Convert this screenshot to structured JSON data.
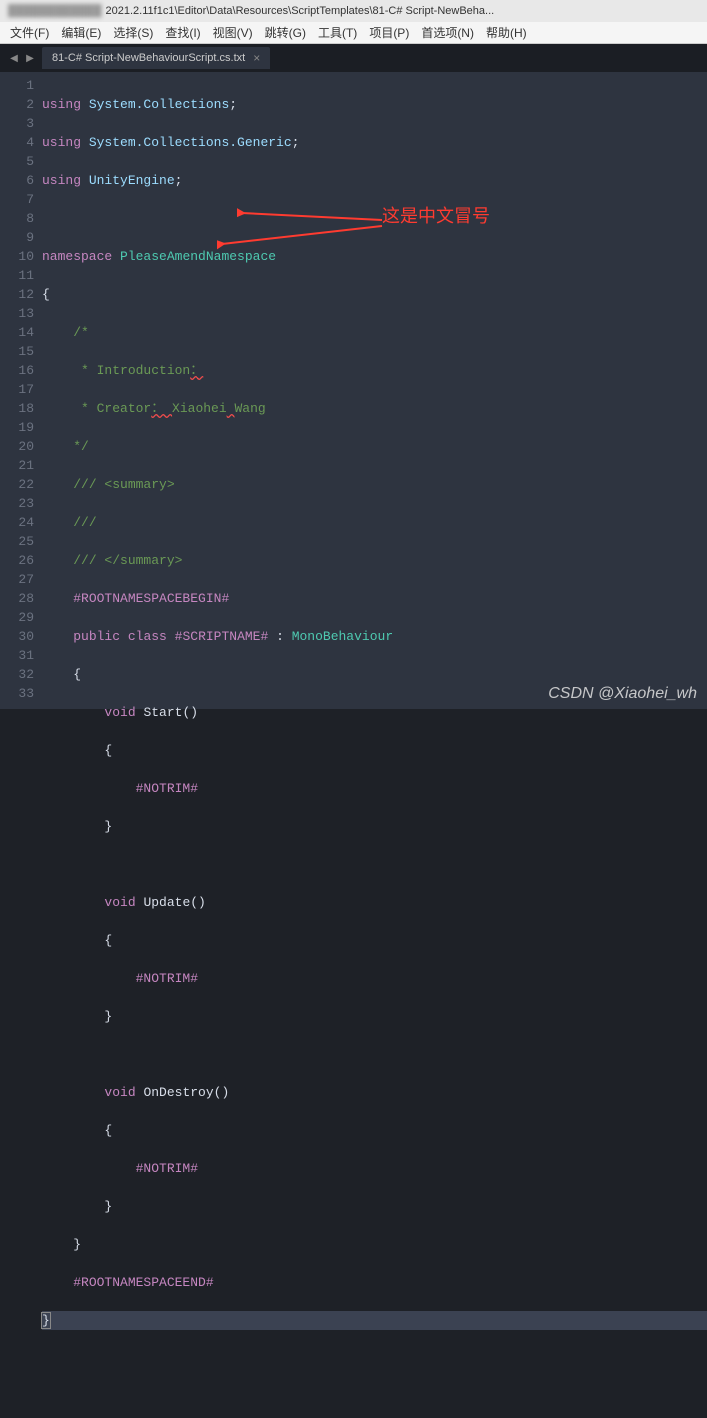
{
  "titlebar": {
    "blurred": "████████████",
    "path": "2021.2.11f1c1\\Editor\\Data\\Resources\\ScriptTemplates\\81-C# Script-NewBeha..."
  },
  "menu": {
    "file": "文件(F)",
    "edit": "编辑(E)",
    "select": "选择(S)",
    "find": "查找(I)",
    "view": "视图(V)",
    "goto": "跳转(G)",
    "tools": "工具(T)",
    "project": "项目(P)",
    "preferences": "首选项(N)",
    "help": "帮助(H)"
  },
  "tab": {
    "label": "81-C# Script-NewBehaviourScript.cs.txt",
    "close": "×"
  },
  "nav": {
    "left": "◀",
    "right": "▶"
  },
  "lines": {
    "count": 33,
    "1": "using System.Collections;",
    "2": "using System.Collections.Generic;",
    "3": "using UnityEngine;",
    "4": "",
    "5": "namespace PleaseAmendNamespace",
    "6": "{",
    "7": "    /*",
    "8": "     * Introduction：",
    "9": "     * Creator： Xiaohei Wang",
    "10": "    */",
    "11": "    /// <summary>",
    "12": "    ///",
    "13": "    /// </summary>",
    "14": "    #ROOTNAMESPACEBEGIN#",
    "15": "    public class #SCRIPTNAME# : MonoBehaviour",
    "16": "    {",
    "17": "        void Start()",
    "18": "        {",
    "19": "            #NOTRIM#",
    "20": "        }",
    "21": "",
    "22": "        void Update()",
    "23": "        {",
    "24": "            #NOTRIM#",
    "25": "        }",
    "26": "",
    "27": "        void OnDestroy()",
    "28": "        {",
    "29": "            #NOTRIM#",
    "30": "        }",
    "31": "    }",
    "32": "    #ROOTNAMESPACEEND#",
    "33": "}"
  },
  "annotation": {
    "label": "这是中文冒号"
  },
  "watermark": {
    "text": "CSDN @Xiaohei_wh"
  }
}
